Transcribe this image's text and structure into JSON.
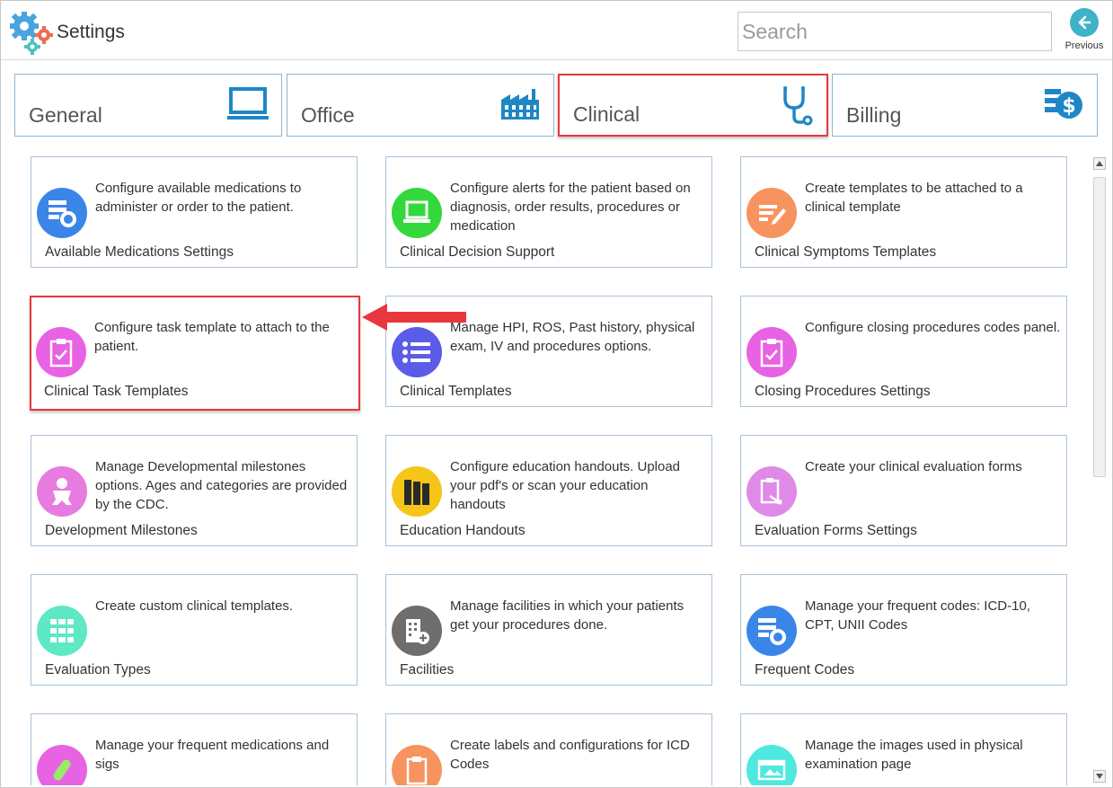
{
  "header": {
    "title": "Settings",
    "search_placeholder": "Search",
    "previous_label": "Previous"
  },
  "tabs": [
    {
      "label": "General",
      "icon": "monitor-icon",
      "active": false
    },
    {
      "label": "Office",
      "icon": "factory-icon",
      "active": false
    },
    {
      "label": "Clinical",
      "icon": "stethoscope-icon",
      "active": true
    },
    {
      "label": "Billing",
      "icon": "billing-icon",
      "active": false
    }
  ],
  "cards": [
    {
      "title": "Available Medications Settings",
      "desc": "Configure available medications to administer or order to the patient.",
      "icon": "settings-list-icon",
      "color": "#3a86e8"
    },
    {
      "title": "Clinical Decision Support",
      "desc": "Configure alerts for the patient based on diagnosis, order results, procedures or medication",
      "icon": "laptop-icon",
      "color": "#33d93a"
    },
    {
      "title": "Clinical Symptoms Templates",
      "desc": "Create templates to be attached to a clinical template",
      "icon": "edit-list-icon",
      "color": "#f7935f"
    },
    {
      "title": "Clinical Task Templates",
      "desc": "Configure task template to attach to the patient.",
      "icon": "clipboard-check-icon",
      "color": "#e862e4"
    },
    {
      "title": "Clinical Templates",
      "desc": "Manage HPI, ROS, Past history, physical exam, IV and procedures options.",
      "icon": "list-icon",
      "color": "#5b5ce8"
    },
    {
      "title": "Closing Procedures Settings",
      "desc": "Configure closing procedures codes panel.",
      "icon": "clipboard-check-icon",
      "color": "#e862e4"
    },
    {
      "title": "Development Milestones",
      "desc": "Manage Developmental milestones options. Ages and categories are provided by the CDC.",
      "icon": "baby-icon",
      "color": "#e87be0"
    },
    {
      "title": "Education Handouts",
      "desc": "Configure education handouts. Upload your pdf's or scan your education handouts",
      "icon": "books-icon",
      "color": "#f5c518"
    },
    {
      "title": "Evaluation Forms Settings",
      "desc": "Create your clinical evaluation forms",
      "icon": "form-edit-icon",
      "color": "#e08ae8"
    },
    {
      "title": "Evaluation Types",
      "desc": "Create custom clinical templates.",
      "icon": "grid-icon",
      "color": "#5ee8c6"
    },
    {
      "title": "Facilities",
      "desc": "Manage facilities in which your patients get your procedures done.",
      "icon": "building-add-icon",
      "color": "#6e6e6e"
    },
    {
      "title": "Frequent Codes",
      "desc": "Manage your frequent codes: ICD-10, CPT, UNII Codes",
      "icon": "settings-list-icon",
      "color": "#3a86e8"
    },
    {
      "title": "",
      "desc": "Manage your frequent medications and sigs",
      "icon": "pill-icon",
      "color": "#e862e4"
    },
    {
      "title": "",
      "desc": "Create labels and configurations for ICD Codes",
      "icon": "clipboard-icon",
      "color": "#f7935f"
    },
    {
      "title": "",
      "desc": "Manage the images used in physical examination page",
      "icon": "image-icon",
      "color": "#4ee8e0"
    }
  ]
}
